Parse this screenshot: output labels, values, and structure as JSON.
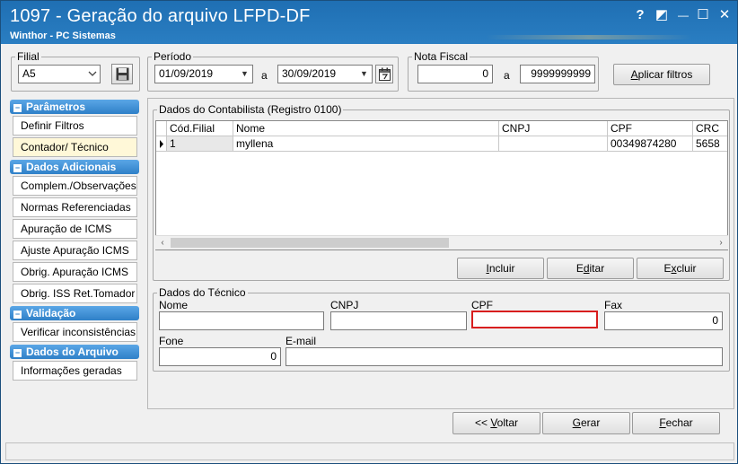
{
  "window": {
    "title": "1097 - Geração do arquivo LFPD-DF",
    "subtitle": "Winthor - PC Sistemas",
    "help": "?",
    "restore": "◩",
    "minimize": "—",
    "maximize": "☐",
    "close": "✕"
  },
  "filial": {
    "legend": "Filial",
    "value": "A5"
  },
  "periodo": {
    "legend": "Período",
    "from": "01/09/2019",
    "sep": "a",
    "to": "30/09/2019"
  },
  "nota_fiscal": {
    "legend": "Nota Fiscal",
    "from": "0",
    "sep": "a",
    "to": "9999999999"
  },
  "aplicar": {
    "label_u": "A",
    "label_rest": "plicar filtros"
  },
  "sidebar": {
    "parametros": "Parâmetros",
    "definir_filtros": "Definir Filtros",
    "contador_tecnico": "Contador/ Técnico",
    "dados_adicionais": "Dados Adicionais",
    "complem": "Complem./Observações",
    "normas": "Normas Referenciadas",
    "apuracao_icms": "Apuração de ICMS",
    "ajuste_apuracao": "Ajuste Apuração ICMS",
    "obrig_apuracao": "Obrig. Apuração ICMS",
    "obrig_iss": "Obrig. ISS Ret.Tomador",
    "validacao": "Validação",
    "verificar": "Verificar inconsistências",
    "dados_arquivo": "Dados do Arquivo",
    "informacoes": "Informações geradas"
  },
  "contabilista": {
    "legend": "Dados do Contabilista (Registro 0100)",
    "columns": [
      "Cód.Filial",
      "Nome",
      "CNPJ",
      "CPF",
      "CRC"
    ],
    "rows": [
      {
        "cod_filial": "1",
        "nome": "myllena",
        "cnpj": "",
        "cpf": "00349874280",
        "crc": "5658"
      }
    ]
  },
  "grid_buttons": {
    "incluir_u": "I",
    "incluir_rest": "ncluir",
    "editar_pre": "E",
    "editar_u": "d",
    "editar_rest": "itar",
    "excluir_pre": "E",
    "excluir_u": "x",
    "excluir_rest": "cluir"
  },
  "tecnico": {
    "legend": "Dados do Técnico",
    "nome_label": "Nome",
    "nome_value": "",
    "cnpj_label": "CNPJ",
    "cnpj_value": "",
    "cpf_label": "CPF",
    "cpf_value": "",
    "fax_label": "Fax",
    "fax_value": "0",
    "fone_label": "Fone",
    "fone_value": "0",
    "email_label": "E-mail",
    "email_value": ""
  },
  "footer": {
    "voltar_pre": "<< ",
    "voltar_u": "V",
    "voltar_rest": "oltar",
    "gerar_u": "G",
    "gerar_rest": "erar",
    "fechar_u": "F",
    "fechar_rest": "echar"
  },
  "colors": {
    "title_bar": "#1f6fb3",
    "section_head": "#2f80c8",
    "invalid_border": "#d81e1e"
  }
}
